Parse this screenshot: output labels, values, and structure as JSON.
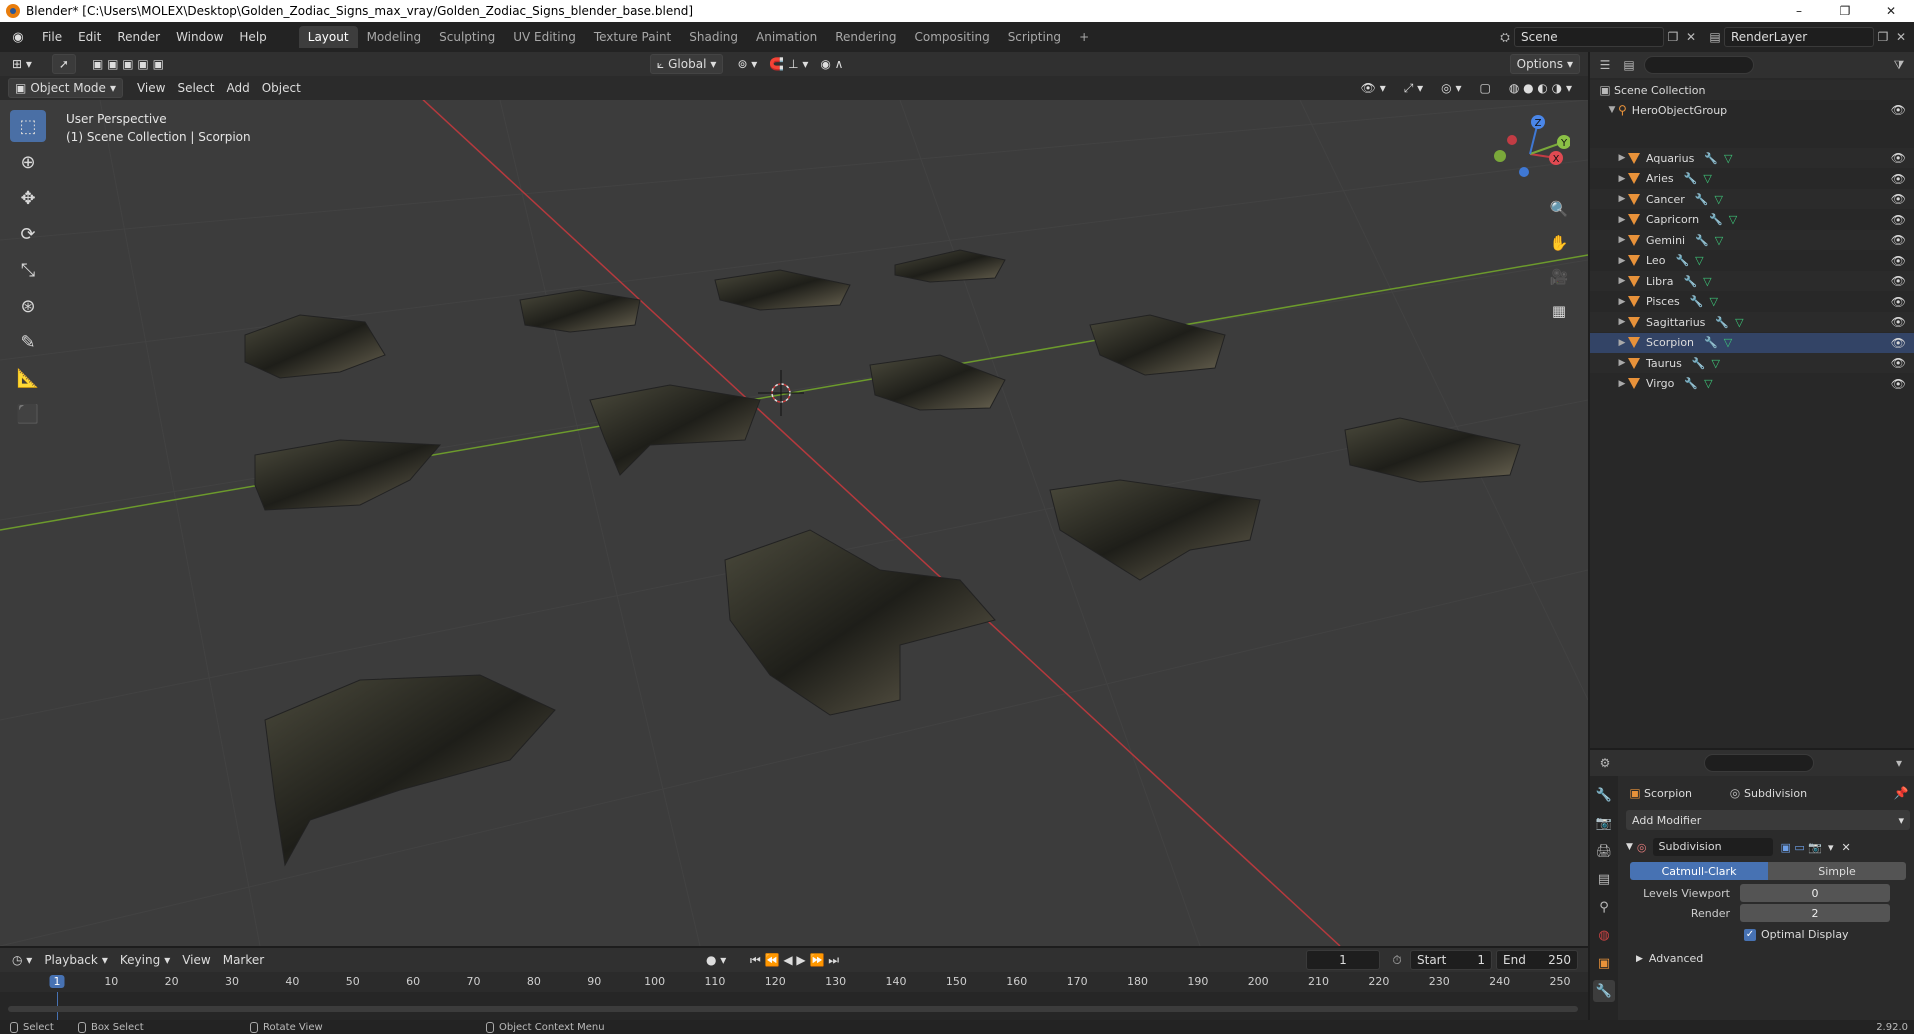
{
  "window": {
    "title": "Blender* [C:\\Users\\MOLEX\\Desktop\\Golden_Zodiac_Signs_max_vray/Golden_Zodiac_Signs_blender_base.blend]",
    "min_glyph": "–",
    "max_glyph": "❐",
    "close_glyph": "✕"
  },
  "menubar": {
    "menus": [
      "File",
      "Edit",
      "Render",
      "Window",
      "Help"
    ],
    "workspaces": [
      "Layout",
      "Modeling",
      "Sculpting",
      "UV Editing",
      "Texture Paint",
      "Shading",
      "Animation",
      "Rendering",
      "Compositing",
      "Scripting"
    ],
    "active_workspace": "Layout",
    "add_workspace": "+",
    "scene": "Scene",
    "render_layer": "RenderLayer"
  },
  "viewport_header": {
    "transform_orientation": "Global",
    "options": "Options",
    "mode": "Object Mode",
    "menus": [
      "View",
      "Select",
      "Add",
      "Object"
    ]
  },
  "viewport": {
    "perspective": "User Perspective",
    "context": "(1) Scene Collection | Scorpion",
    "gizmo_axes": {
      "x": "X",
      "y": "Y",
      "z": "Z"
    }
  },
  "outliner": {
    "root": "Scene Collection",
    "group": "HeroObjectGroup",
    "objects": [
      "Aquarius",
      "Aries",
      "Cancer",
      "Capricorn",
      "Gemini",
      "Leo",
      "Libra",
      "Pisces",
      "Sagittarius",
      "Scorpion",
      "Taurus",
      "Virgo"
    ]
  },
  "properties": {
    "object_name": "Scorpion",
    "modifier_name": "Subdivision",
    "add_modifier": "Add Modifier",
    "modifier_field": "Subdivision",
    "algorithms": [
      "Catmull-Clark",
      "Simple"
    ],
    "active_algorithm": "Catmull-Clark",
    "levels_viewport_label": "Levels Viewport",
    "levels_viewport": "0",
    "render_label": "Render",
    "render": "2",
    "optimal_display": "Optimal Display",
    "advanced": "Advanced"
  },
  "timeline": {
    "menus": [
      "Playback",
      "Keying",
      "View",
      "Marker"
    ],
    "current_frame": "1",
    "start_label": "Start",
    "start": "1",
    "end_label": "End",
    "end": "250",
    "ticks": [
      "1",
      "10",
      "20",
      "30",
      "40",
      "50",
      "60",
      "70",
      "80",
      "90",
      "100",
      "110",
      "120",
      "130",
      "140",
      "150",
      "160",
      "170",
      "180",
      "190",
      "200",
      "210",
      "220",
      "230",
      "240",
      "250"
    ]
  },
  "statusbar": {
    "select": "Select",
    "box_select": "Box Select",
    "rotate_view": "Rotate View",
    "context_menu": "Object Context Menu",
    "version": "2.92.0"
  },
  "colors": {
    "accent": "#4772b3",
    "x_axis": "#b5393d",
    "y_axis": "#6c9a2c",
    "object_orange": "#e8923a",
    "mesh_green": "#3ec77a"
  }
}
